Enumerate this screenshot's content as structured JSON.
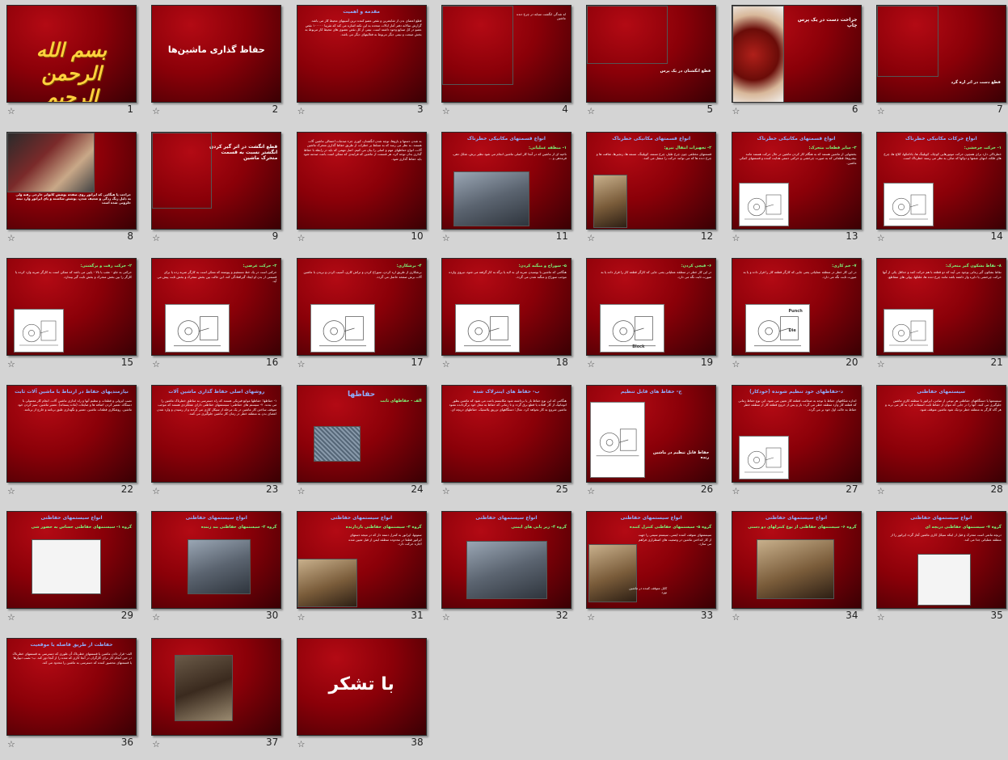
{
  "slides": [
    {
      "n": "1",
      "kind": "bism",
      "title": "بسم الله الرحمن الرحیم"
    },
    {
      "n": "2",
      "kind": "titleonly",
      "title": "حفاظ گذاری ماشین‌ها"
    },
    {
      "n": "3",
      "kind": "text",
      "title": "مقدمه و اهمیت",
      "body": "قطع اعضای بدن از شایعترین و نقص عضو کننده ترین آسیبهای محیط کار می باشد. گزارش سالانه دفتر آمار ایالات متحده به این نکته اشاره می کند که تقریبا ۱۰۰۰۰۰ نقص عضو در کل صنایع وجود داشته است. نیمی از کل نقص عضوی های محیط کار مربوط به بخش صنعت و نیمی دیگر مربوط به فعالیتهای دیگر می باشد."
    },
    {
      "n": "4",
      "kind": "photo-left",
      "title": "",
      "body": "له شدگی انگشت سبابه در چرخ دنده ماشین"
    },
    {
      "n": "5",
      "kind": "photo-top",
      "title": "",
      "body": "قطع انگشتان در یک پرس"
    },
    {
      "n": "6",
      "kind": "photo-left",
      "title": "جراحت دست در یک پرس چاپ",
      "body": ""
    },
    {
      "n": "7",
      "kind": "photo-top",
      "title": "",
      "body": "قطع دست در اثر اره گرد"
    },
    {
      "n": "8",
      "kind": "photo-top",
      "title": "",
      "body": "جراحت پا هنگامی که اپراتور روی صفحه پوشش کانوایر خارجی رفته ولی به دلیل زنگ زدگی و ضعیف شدن، پوشش شکسته و پای اپراتور وارد تیغه حلزونی شده است"
    },
    {
      "n": "9",
      "kind": "photo-left",
      "title": "قطع انگشت در اثر گیر کردن انگشتر نسبت به قسمت متحرک ماشین",
      "body": ""
    },
    {
      "n": "10",
      "kind": "text",
      "title": "",
      "body": "به شدن دستها و بازوها، نوچه شدن انگشتان، کوری جزء صدمات احتمالی ماشین آلات هستند. به نظر می رسد که به تسلط بر خطرات از طریق حفاظ گذاری متحرک ماشین آلات، انواع حفاظهای مهم و اصلی را بیان می کنیم. اصل مهمی که باید در رابطه با حفاظ گذاری بدان توجه کرد، هر قسمت از ماشین که فرایندی که ممکن است باعث صدمه شود باید حفاظ گذاری شود."
    },
    {
      "n": "11",
      "kind": "text-photo",
      "title": "انواع قسمتهای مکانیکی خطرناک",
      "sub": "۱- منطقه عملیاتی:",
      "body": "ناحیه ای از ماشین که در آنجا کار اصلی ماشین انجام می شود نظیر برش، شکل دهی، فرمدهی و ..."
    },
    {
      "n": "12",
      "kind": "text-photo",
      "title": "انواع قسمتهای مکانیکی خطرناک",
      "sub": "۲- تجهیزات انتقال نیرو:",
      "body": "قسمتهای مختلفی چون چرخ طیار، چرخ تسمه، کوپلینگ، تسمه ها، زنجیرها، شافت ها و چرخ دنده ها که می توانند حرکت را منتقل می کنند."
    },
    {
      "n": "13",
      "kind": "text-pic",
      "title": "انواع قسمتهای مکانیکی خطرناک",
      "sub": "۳- سایر قطعات متحرک:",
      "body": "بخشهایی از ماشین هستند که به هنگام کار کردن ماشین در حال حرکت هستند مانند بیشروها، قطعاتی که به صورت چرخشی و حرکتی دستی هدایت کننده و قسمتهای کمکی ماشین."
    },
    {
      "n": "14",
      "kind": "text-pic",
      "title": "انواع حرکات مکانیکی خطرناک",
      "sub": "۱- حرکت چرخشی:",
      "body": "خطرناکی دارد برای همچون حرکت موتورهایی کوچک، کوپلینگ ها، بادامکها، کلاچ ها، چرخ های فلکه، انتهای شفتها و دوکها که صاف به نظر می رسند خطرناک است."
    },
    {
      "n": "15",
      "kind": "text-pic",
      "title": "",
      "sub": "۲- حرکت رفت و برگشتی:",
      "body": "حرکتی به جلو - عقب یا بالا - پایین می باشد که ممکن است به کارگر ضربه وارد کرده یا کارگر را بین بخش متحرک و بخش ثابت گیر بیندازد."
    },
    {
      "n": "16",
      "kind": "text-pic",
      "title": "",
      "sub": "۳- حرکت عرضی:",
      "body": "حرکتی است در یک خط مستقیم و پیوسته که ممکن است به کارگر ضربه زده یا برای قسمتی از بدن او ایجاد گیرافتادگی کند. این حالت بین بخش متحرک و بخش ثابت پیش می آید."
    },
    {
      "n": "17",
      "kind": "text-pic",
      "title": "",
      "sub": "۴- برشکاری:",
      "body": "برشکاری از طریق اره کردن، سوراخ کردن و تراش کاری، آسیب کردن و بریدن با ماشین آلات برش صفحه حاصل می گردد."
    },
    {
      "n": "18",
      "kind": "text-pic",
      "title": "",
      "sub": "۵- سوراخ و منگنه کردن:",
      "body": "هنگامی که ماشین با بوسیدن ضربه ای به لایه یا برگه به کار گرفته می شود، نیروی وارده موجب سوراخ و منگنه شدن می گردد."
    },
    {
      "n": "19",
      "kind": "text-pic",
      "title": "",
      "sub": "۶- قیچی کردن:",
      "body": "در این کار خطر در منطقه عملیاتی یعنی جایی که کارگر قطعه کار را قرار داده یا به صورت ثابت نگه می دارد."
    },
    {
      "n": "20",
      "kind": "text-pic",
      "title": "",
      "sub": "۷- خم کاری:",
      "body": "در این کار خطر در منطقه عملیاتی یعنی جایی که کارگر قطعه کار را قرار داده و یا به صورت ثابت نگه می دارد."
    },
    {
      "n": "21",
      "kind": "text-pic",
      "title": "",
      "sub": "۸- نقاط بشکون گیر متحرک:",
      "body": "نقاط بشکون گیر زمانی بوجود می آیند که دو قطعه با هم حرکت کنند و حداقل یکی از آنها حرکت چرخشی یا دایره وار داشته باشد مانند چرخ دنده ها، غلتکها، پولی های متقاطع."
    },
    {
      "n": "22",
      "kind": "text",
      "title": "نیازمندیهای حفاظ در ارتباط با ماشین آلات ثابت",
      "body": "نصب ایزولی و قطعات و تنظیم آنها و راه اندازی ماشین آلات. انجام کار معمولی با دستگاه. تعمیر کردن اضافه ها و ضایعات (ماده پسماند). تعمیر ماشین. تمیز کردن خود ماشین. روغنکاری قطعات ماشین. تعمیر و نگهداری طبق برنامه و خارج از برنامه."
    },
    {
      "n": "23",
      "kind": "text",
      "title": "روشهای اصلی حفاظ گذاری ماشین آلات",
      "body": "۱- حفاظها: حفاظها موانع فیزیکی هستند که راه دسترسی به مناطق خطرناک ماشین را می بندند. ۲- سیستم های حفاظتی: سیستمهای حفاظتی دارای عملکردی هستند که موجب متوقف ساختن کار ماشین در یک مرحله از سیکل کاری می گردند و از رسیدن و وارد شدن اعضای بدن به منطقه خطر در زمان کار ماشین جلوگیری می کنند."
    },
    {
      "n": "24",
      "kind": "title-pic",
      "title": "حفاظها",
      "sub": "الف - حفاظهای ثابت",
      "body": ""
    },
    {
      "n": "25",
      "kind": "text",
      "title": "ب- حفاظ های اینترلاک شده",
      "body": "هنگامی که این نوع حفاظ باز یا برداشته شود مکانیسم باعث می شود که ماشین بطور اتوماتیک از کار افتاده یا قطع برق گردد و تا زمانی که حفاظ به محل خود برگردانده نشود ماشین شروع به کار نخواهد کرد. مثال: دستگاههای تزریق پلاستیک، حفاظهای دریچه ای."
    },
    {
      "n": "26",
      "kind": "pic-caption",
      "title": "ج- حفاظ های قابل تنظیم",
      "sub": "",
      "body": "حفاظ قابل تنظیم در ماشین رنده"
    },
    {
      "n": "27",
      "kind": "text-pic",
      "title": "د-حفاظهای خود تنظیم شونده (خودکار)",
      "sub": "",
      "body": "اندازه شکافهای حفاظ با توجه به ضخامت قطعه کار تعیین می شود. این نوع حفاظ زمانی که قطعه کار وارد منطقه خطر می گردد باز و پس از خروج قطعه کار از منطقه خطر حفاظ به حالت اول خود بر می گردد."
    },
    {
      "n": "28",
      "kind": "text",
      "title": "سیستمهای حفاظتی",
      "body": "سیستمها یا دستگاههای حفاظتی هر نوعی از ضامن، اپراتور یا منطقه کاری ماشین جلوگیری می کنند. آنها را در جایی که نتوان از حفاظ ثابت استفاده کرد به کار می برند و هر گاه کارگر به منطقه خطر نزدیک شود ماشین متوقف شود."
    },
    {
      "n": "29",
      "kind": "title-photo",
      "title": "انواع سیستمهای حفاظتی",
      "sub": "گروه ۱- سیستمهای حفاظتی حساس به حضور شی",
      "body": ""
    },
    {
      "n": "30",
      "kind": "title-photo",
      "title": "انواع سیستمهای حفاظتی",
      "sub": "گروه ۲- سیستمهای حفاظتی بند زننده",
      "body": ""
    },
    {
      "n": "31",
      "kind": "title-photo",
      "title": "انواع سیستمهای حفاظتی",
      "sub": "گروه ۳- سیستمهای حفاظتی بازدارنده",
      "body": "ستونها، اپراتور به کنترل دسته دار که در نتیجه دستهای اپراتور قطعا در محدوده منطقه ایمن از قبل تعیین شده اجازه حرکت دارد."
    },
    {
      "n": "32",
      "kind": "title-photo",
      "title": "انواع سیستمهای حفاظتی",
      "sub": "گروه ۴- زیر پایی های ایمنی",
      "body": ""
    },
    {
      "n": "33",
      "kind": "title-photo",
      "title": "انواع سیستمهای حفاظتی",
      "sub": "گروه ۵- سیستمهای حفاظتی کنترل کننده",
      "body": "سیستمهای متوقف کننده ایمنی، سیستم سیمی را جهت از کار انداختن ماشین در وضعیت های اضطراری فراهم می سازد."
    },
    {
      "n": "34",
      "kind": "title-photo",
      "title": "انواع سیستمهای حفاظتی",
      "sub": "گروه ۶- سیستمهای حفاظتی از نوع کنترلهای دو دستی",
      "body": ""
    },
    {
      "n": "35",
      "kind": "title-photo",
      "title": "انواع سیستمهای حفاظتی",
      "sub": "گروه ۷- سیستمهای حفاظتی دریچه ای",
      "body": "دریچه مانعی است متحرک و قبل از اینکه سیکل کاری ماشین آغاز گردد اپراتور را از منطقه عملیاتی جدا می کند."
    },
    {
      "n": "36",
      "kind": "text",
      "title": "حفاظت از طریق فاصله یا موقعیت",
      "body": "الف- قرار دادن ماشین یا قسمتهای خطرناک آن طوری که دسترسی به قسمتهای خطرناک در حین انجام کار برای کارگران در آنجا کاری که شده را از آنجا دور کند. ب- نصب دیوارها یا قسمتهای محصور کننده که دسترسی به ماشین را محدود می کند."
    },
    {
      "n": "37",
      "kind": "photo-only",
      "title": "",
      "body": ""
    },
    {
      "n": "38",
      "kind": "titleonly",
      "title": "با تشکر"
    }
  ],
  "captions": {
    "c11": "نمایش ماشین",
    "c12": "ماشین",
    "c19_block": "Block",
    "c20_a": "Punch",
    "c20_b": "Die",
    "c26": "حفاظ قابل تنظیم در ماشین رنده",
    "c33": "کابل متوقف کننده در ماشین نورد"
  },
  "rating_icon": "star-outline-icon",
  "colors": {
    "slide_red": "#8a0008",
    "slide_dark": "#3a0004",
    "title_blue": "#8fb0ff",
    "sub_green": "#7dff7d",
    "sorter_bg": "#d4d4d4"
  }
}
